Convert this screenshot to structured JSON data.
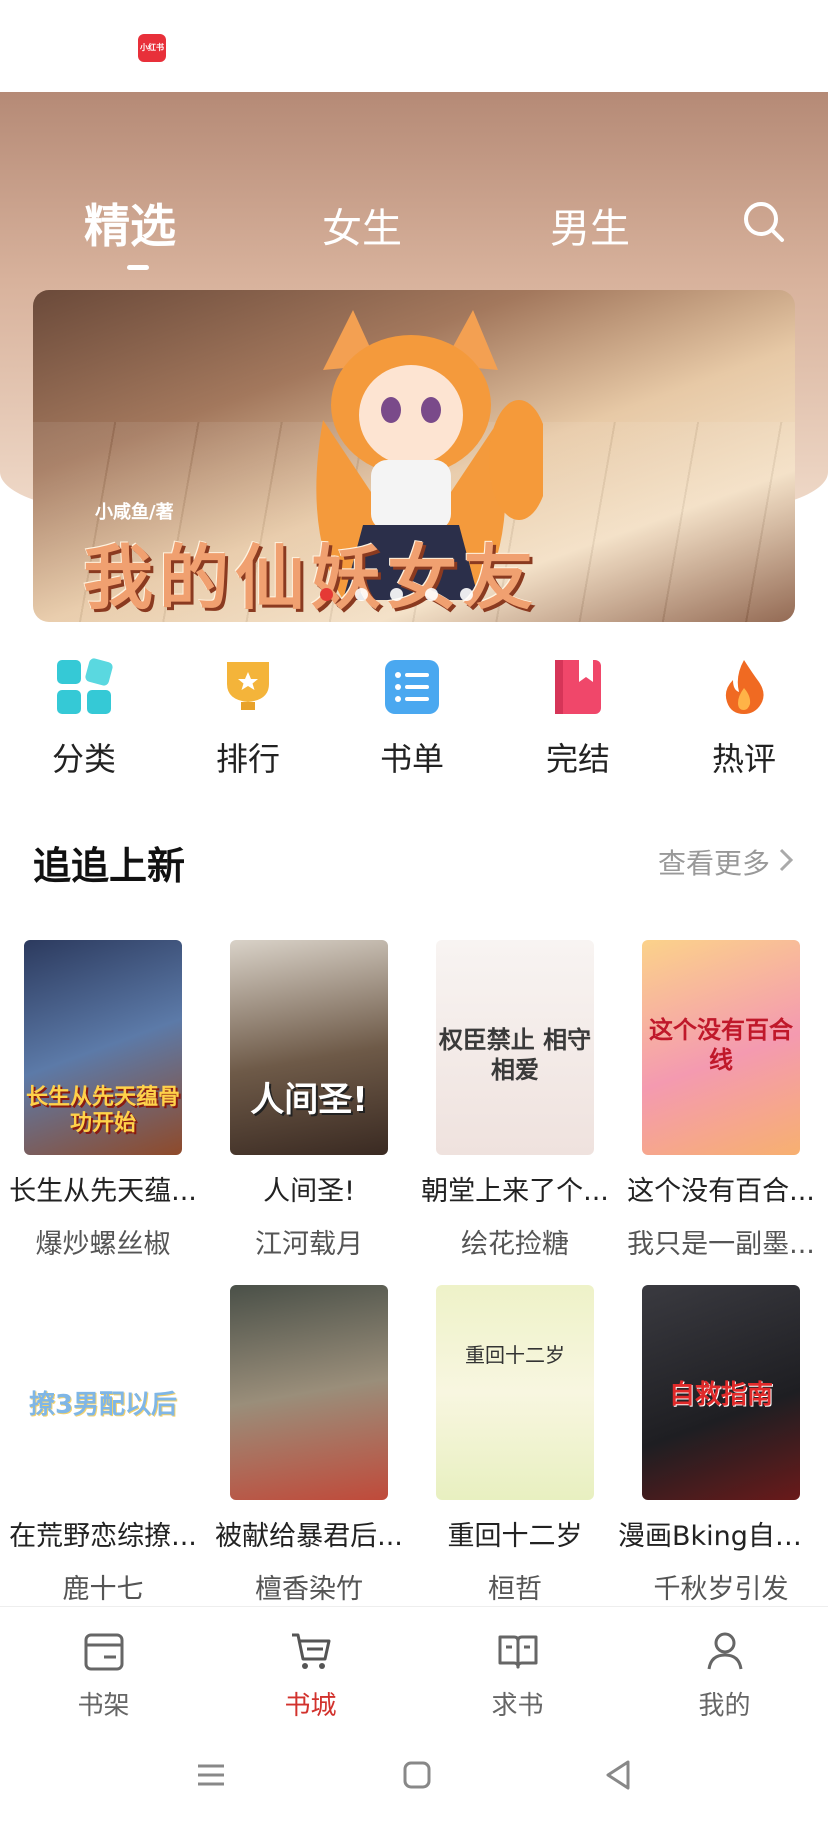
{
  "status_bar": {
    "app_badge": "小红书"
  },
  "tabs": [
    {
      "label": "精选",
      "active": true
    },
    {
      "label": "女生",
      "active": false
    },
    {
      "label": "男生",
      "active": false
    }
  ],
  "banner": {
    "author": "小咸鱼/著",
    "title": "我的仙妖女友",
    "slide_count": 5,
    "active_slide": 1
  },
  "quick_links": [
    {
      "label": "分类",
      "icon": "grid-icon",
      "color": "#35c9d6"
    },
    {
      "label": "排行",
      "icon": "trophy-icon",
      "color": "#f4b43a"
    },
    {
      "label": "书单",
      "icon": "list-icon",
      "color": "#4aa8f0"
    },
    {
      "label": "完结",
      "icon": "bookmark-book-icon",
      "color": "#f0476a"
    },
    {
      "label": "热评",
      "icon": "flame-icon",
      "color": "#f06a22"
    }
  ],
  "section": {
    "title": "追追上新",
    "more_label": "查看更多"
  },
  "books": [
    {
      "title": "长生从先天蕴...",
      "author": "爆炒螺丝椒",
      "cover_text": "长生从先天蕴骨功开始",
      "cover_bg": "#3b4a6b",
      "cover_fg": "#ffd24a"
    },
    {
      "title": "人间圣!",
      "author": "江河载月",
      "cover_text": "人间圣!",
      "cover_bg": "#8c7f72",
      "cover_fg": "#ffffff"
    },
    {
      "title": "朝堂上来了个...",
      "author": "绘花捡糖",
      "cover_text": "权臣禁止 相守相爱",
      "cover_bg": "#f3ecea",
      "cover_fg": "#3a3a3a"
    },
    {
      "title": "这个没有百合...",
      "author": "我只是一副墨...",
      "cover_text": "这个没有百合线",
      "cover_bg": "#f7c07a",
      "cover_fg": "#c0182a"
    },
    {
      "title": "在荒野恋综撩...",
      "author": "鹿十七",
      "cover_text": "撩3男配以后",
      "cover_bg": "#ffffff",
      "cover_fg": "#7fb6e6"
    },
    {
      "title": "被献给暴君后...",
      "author": "檀香染竹",
      "cover_text": "",
      "cover_bg": "#5a5a52",
      "cover_fg": "#ffffff"
    },
    {
      "title": "重回十二岁",
      "author": "桓哲",
      "cover_text": "重回十二岁",
      "cover_bg": "#f5f3dc",
      "cover_fg": "#333333"
    },
    {
      "title": "漫画Bking自救...",
      "author": "千秋岁引发",
      "cover_text": "自救指南",
      "cover_bg": "#2a2a2e",
      "cover_fg": "#e02a2a"
    }
  ],
  "bottom_nav": [
    {
      "label": "书架",
      "icon": "bookshelf-icon",
      "active": false
    },
    {
      "label": "书城",
      "icon": "cart-icon",
      "active": true
    },
    {
      "label": "求书",
      "icon": "open-book-icon",
      "active": false
    },
    {
      "label": "我的",
      "icon": "person-icon",
      "active": false
    }
  ],
  "colors": {
    "accent": "#d2322d",
    "hero": "#c89f88"
  }
}
